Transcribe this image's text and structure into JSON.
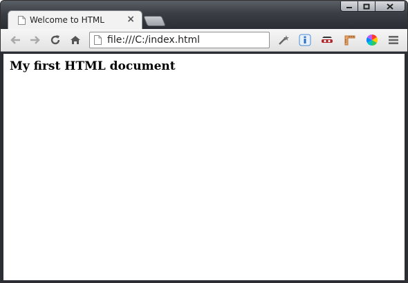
{
  "browser": {
    "tab": {
      "title": "Welcome to HTML"
    },
    "address_bar": {
      "url": "file:///C:/index.html"
    }
  },
  "page": {
    "heading": "My first HTML document"
  },
  "icons": {
    "back": "back-arrow-icon",
    "forward": "forward-arrow-icon",
    "reload": "reload-icon",
    "home": "home-icon",
    "menu": "hamburger-menu-icon"
  },
  "colors": {
    "frame_dark": "#2a2d33",
    "toolbar": "#ececec",
    "tab_active": "#f2f2f2"
  }
}
